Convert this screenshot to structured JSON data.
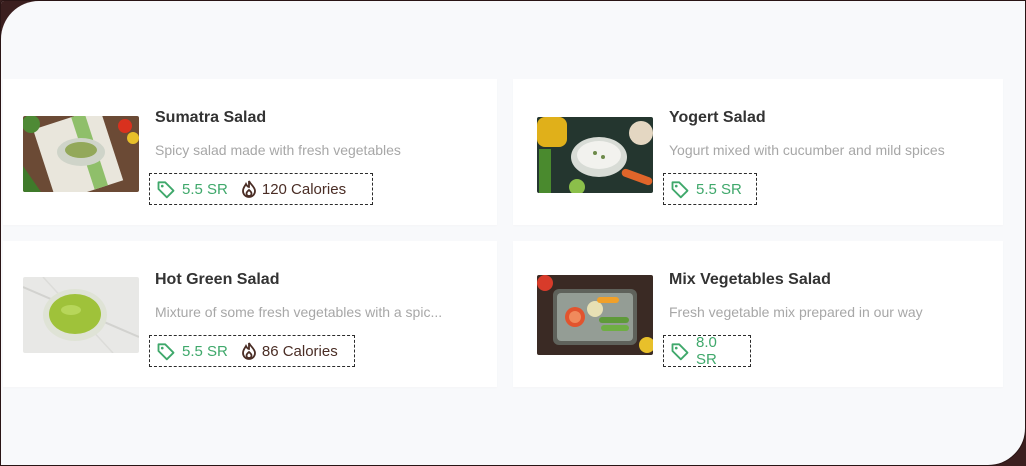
{
  "menu": {
    "items": [
      {
        "title": "Sumatra Salad",
        "description": "Spicy salad made with fresh vegetables",
        "price": "5.5 SR",
        "calories": "120 Calories"
      },
      {
        "title": "Yogert Salad",
        "description": "Yogurt mixed with cucumber and mild spices",
        "price": "5.5 SR"
      },
      {
        "title": "Hot Green Salad",
        "description": "Mixture of some fresh vegetables with a spic...",
        "price": "5.5 SR",
        "calories": "86 Calories"
      },
      {
        "title": "Mix Vegetables Salad",
        "description": "Fresh vegetable mix prepared in our way",
        "price": "8.0 SR"
      }
    ]
  },
  "colors": {
    "price": "#3fa86b",
    "calories": "#4a2d25",
    "title": "#333333",
    "description": "#a7a7a7"
  }
}
